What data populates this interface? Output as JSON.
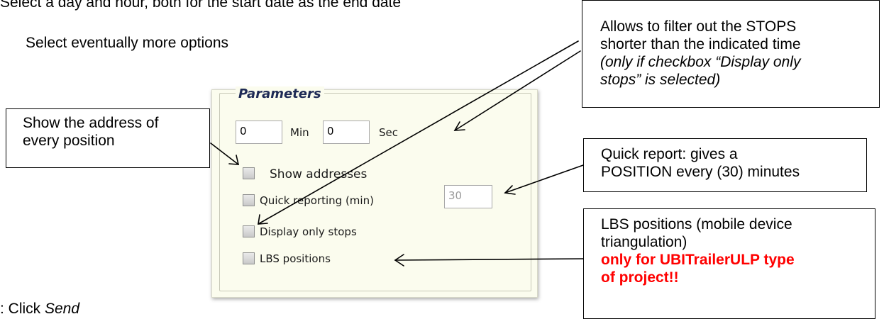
{
  "doc": {
    "line_top": "Select a day and hour, both for the start date as the end date",
    "line_options": "Select eventually more options",
    "line_bottom_prefix": ": Click ",
    "line_bottom_action": "Send"
  },
  "panel": {
    "legend": "Parameters",
    "min_value": "0",
    "min_label": "Min",
    "sec_value": "0",
    "sec_label": "Sec",
    "show_addresses_label": "Show addresses",
    "show_addresses_checked": false,
    "quick_reporting_label": "Quick reporting (min)",
    "quick_reporting_checked": false,
    "quick_reporting_value": "30",
    "display_only_stops_label": "Display only stops",
    "display_only_stops_checked": false,
    "lbs_positions_label": "LBS positions",
    "lbs_positions_checked": false
  },
  "callouts": {
    "address": {
      "line1": "Show the address of",
      "line2": "every position"
    },
    "stops": {
      "line1": "Allows to filter out the STOPS",
      "line2": "shorter than the indicated time",
      "note1": "(only if checkbox “Display only",
      "note2": "stops” is selected)"
    },
    "quick": {
      "line1": "Quick report: gives a",
      "line2": "POSITION every (30) minutes"
    },
    "lbs": {
      "line1": "LBS positions (mobile device",
      "line2": "triangulation)",
      "warn1": "only for UBITrailerULP type",
      "warn2": "of project!!"
    }
  },
  "colors": {
    "panel_background": "#fbfcee",
    "legend_text": "#1e2a55",
    "warning_text": "#ff0000"
  }
}
